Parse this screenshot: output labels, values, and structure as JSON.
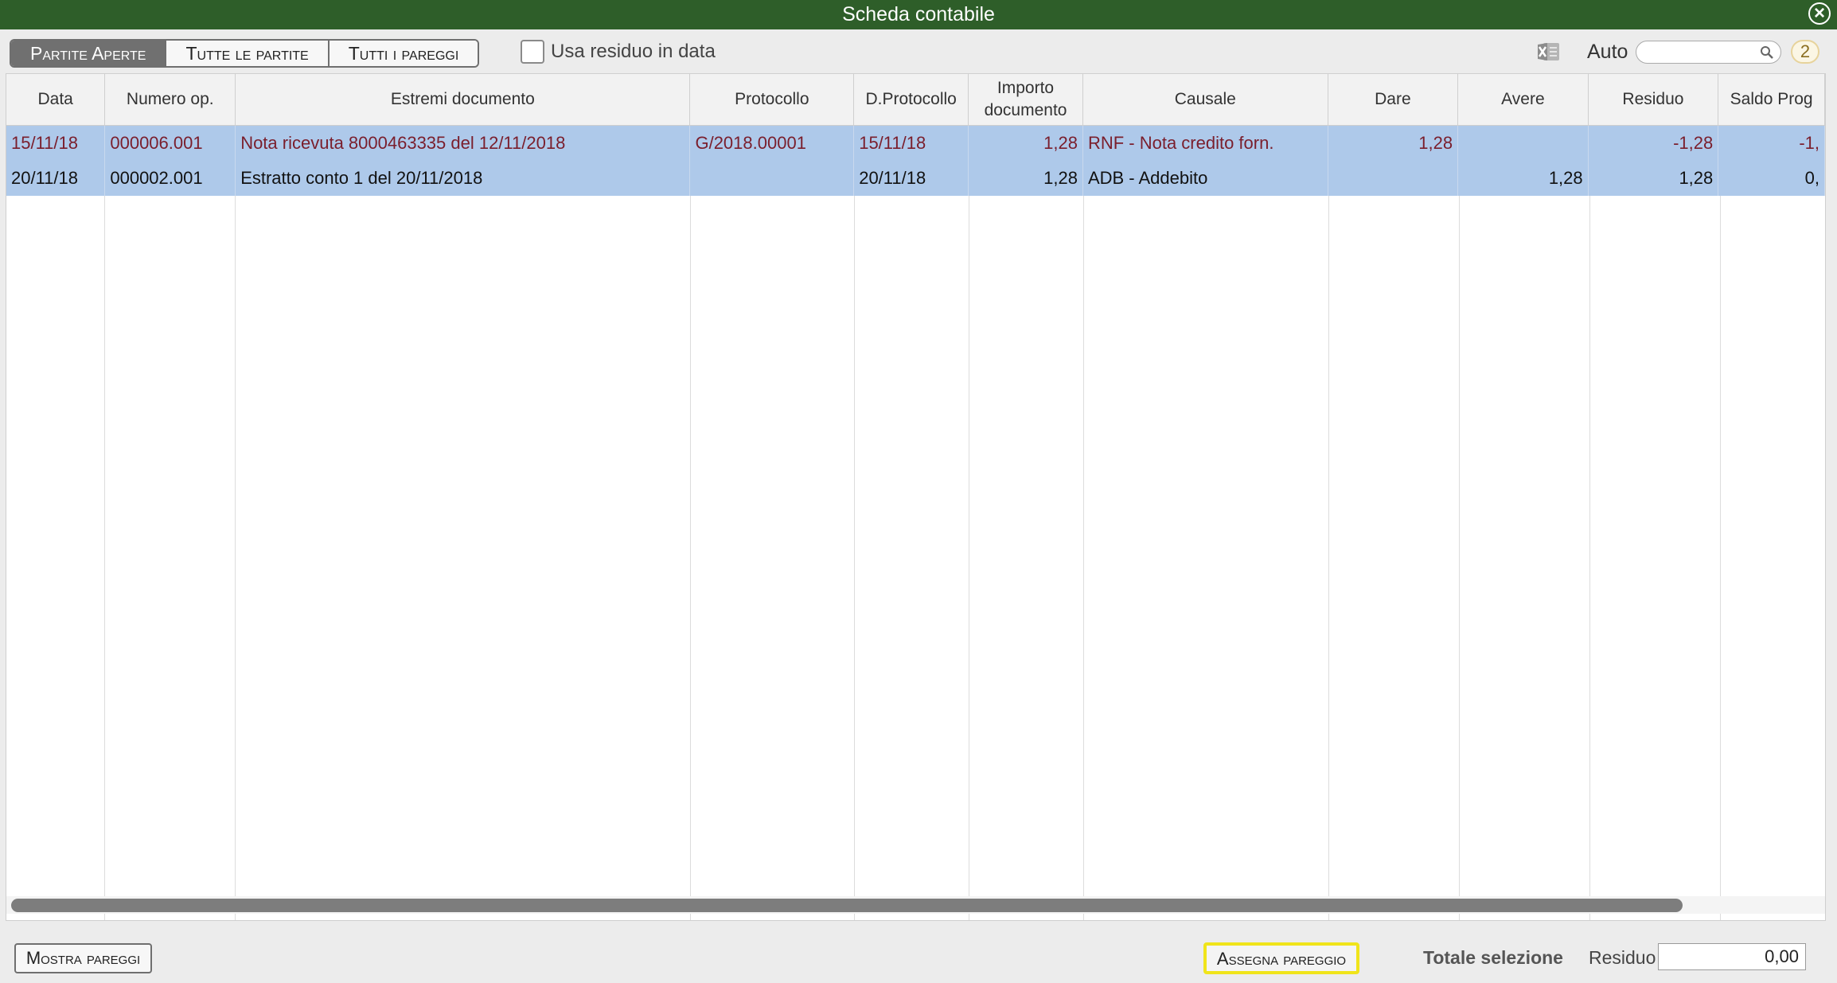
{
  "window": {
    "title": "Scheda contabile"
  },
  "toolbar": {
    "segments": [
      "Partite Aperte",
      "Tutte le partite",
      "Tutti i pareggi"
    ],
    "selected_segment": "Partite Aperte",
    "checkbox_label": "Usa residuo in data",
    "checkbox_checked": false,
    "auto_label": "Auto",
    "search_value": "",
    "count_badge": "2"
  },
  "table": {
    "columns": [
      "Data",
      "Numero op.",
      "Estremi documento",
      "Protocollo",
      "D.Protocollo",
      "Importo documento",
      "Causale",
      "Dare",
      "Avere",
      "Residuo",
      "Saldo Prog"
    ],
    "rows": [
      [
        "15/11/18",
        "000006.001",
        "Nota ricevuta 8000463335 del 12/11/2018",
        "G/2018.00001",
        "15/11/18",
        "1,28",
        "RNF - Nota credito forn.",
        "1,28",
        "",
        "-1,28",
        "-1,"
      ],
      [
        "20/11/18",
        "000002.001",
        "Estratto conto 1 del 20/11/2018",
        "",
        "20/11/18",
        "1,28",
        "ADB - Addebito",
        "",
        "1,28",
        "1,28",
        "0,"
      ]
    ]
  },
  "footer": {
    "mostra_label": "Mostra pareggi",
    "assegna_label": "Assegna pareggio",
    "totale_label": "Totale selezione",
    "residuo_label": "Residuo",
    "residuo_value": "0,00"
  },
  "colors": {
    "titlebar": "#2e5e29",
    "selection": "#aec9ea",
    "credit_text": "#7a1e2c",
    "highlight": "#f0e41a"
  }
}
